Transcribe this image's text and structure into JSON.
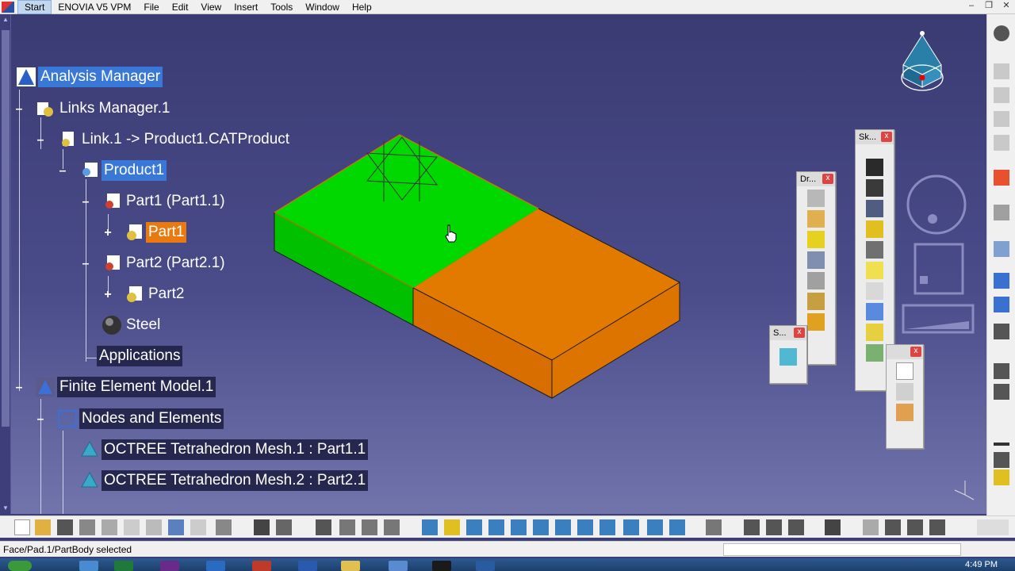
{
  "menu": {
    "items": [
      "Start",
      "ENOVIA V5 VPM",
      "File",
      "Edit",
      "View",
      "Insert",
      "Tools",
      "Window",
      "Help"
    ]
  },
  "tree": {
    "analysis_manager": "Analysis Manager",
    "links_manager": "Links Manager.1",
    "link1": "Link.1 -> Product1.CATProduct",
    "product1": "Product1",
    "part1_instance": "Part1 (Part1.1)",
    "part1": "Part1",
    "part2_instance": "Part2 (Part2.1)",
    "part2": "Part2",
    "material": "Steel",
    "applications": "Applications",
    "fem": "Finite Element Model.1",
    "nodes_elements": "Nodes and Elements",
    "mesh1": "OCTREE Tetrahedron Mesh.1 : Part1.1",
    "mesh2": "OCTREE Tetrahedron Mesh.2 : Part2.1"
  },
  "floating_toolbars": {
    "dr_title": "Dr...",
    "sk_title": "Sk...",
    "s_title": "S..."
  },
  "status": {
    "text": "Face/Pad.1/PartBody selected"
  },
  "taskbar": {
    "clock": "4:49 PM"
  },
  "colors": {
    "part1_face": "#00d400",
    "part2_face": "#e27800",
    "selection": "#3a78d7",
    "highlight": "#e87a10"
  }
}
